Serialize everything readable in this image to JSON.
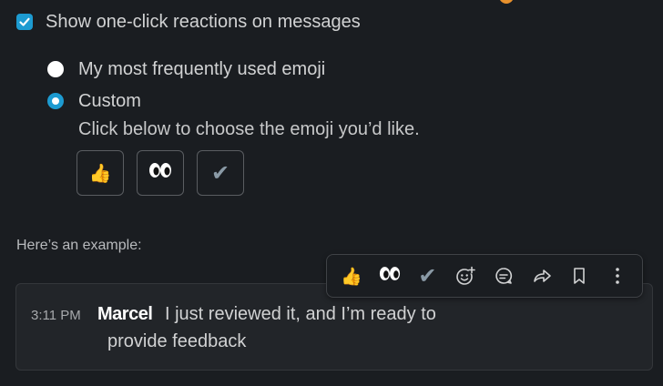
{
  "settings": {
    "one_click_label": "Show one-click reactions on messages",
    "one_click_checked": true,
    "options": [
      {
        "label": "My most frequently used emoji",
        "selected": false
      },
      {
        "label": "Custom",
        "selected": true
      }
    ],
    "helper_text": "Click below to choose the emoji you’d like.",
    "custom_emoji": [
      {
        "icon": "thumbs-up-emoji",
        "glyph": "👍"
      },
      {
        "icon": "eyes-emoji",
        "glyph": "👀"
      },
      {
        "icon": "check-mark-emoji",
        "glyph": "✔"
      }
    ]
  },
  "example": {
    "label": "Here’s an example:",
    "message": {
      "time": "3:11 PM",
      "author": "Marcel",
      "text_line1": "I just reviewed it, and I’m ready to",
      "text_line2": "provide feedback"
    },
    "toolbar": {
      "reactions": [
        {
          "icon": "thumbs-up-emoji",
          "glyph": "👍"
        },
        {
          "icon": "eyes-emoji",
          "glyph": "👀"
        },
        {
          "icon": "check-mark-emoji",
          "glyph": "✔"
        }
      ],
      "actions": [
        "add-reaction-icon",
        "reply-in-thread-icon",
        "forward-icon",
        "save-bookmark-icon",
        "more-actions-icon"
      ]
    }
  },
  "colors": {
    "background": "#1a1d21",
    "accent": "#1d9bd1",
    "card": "#222529",
    "badge": "#e8912d"
  }
}
